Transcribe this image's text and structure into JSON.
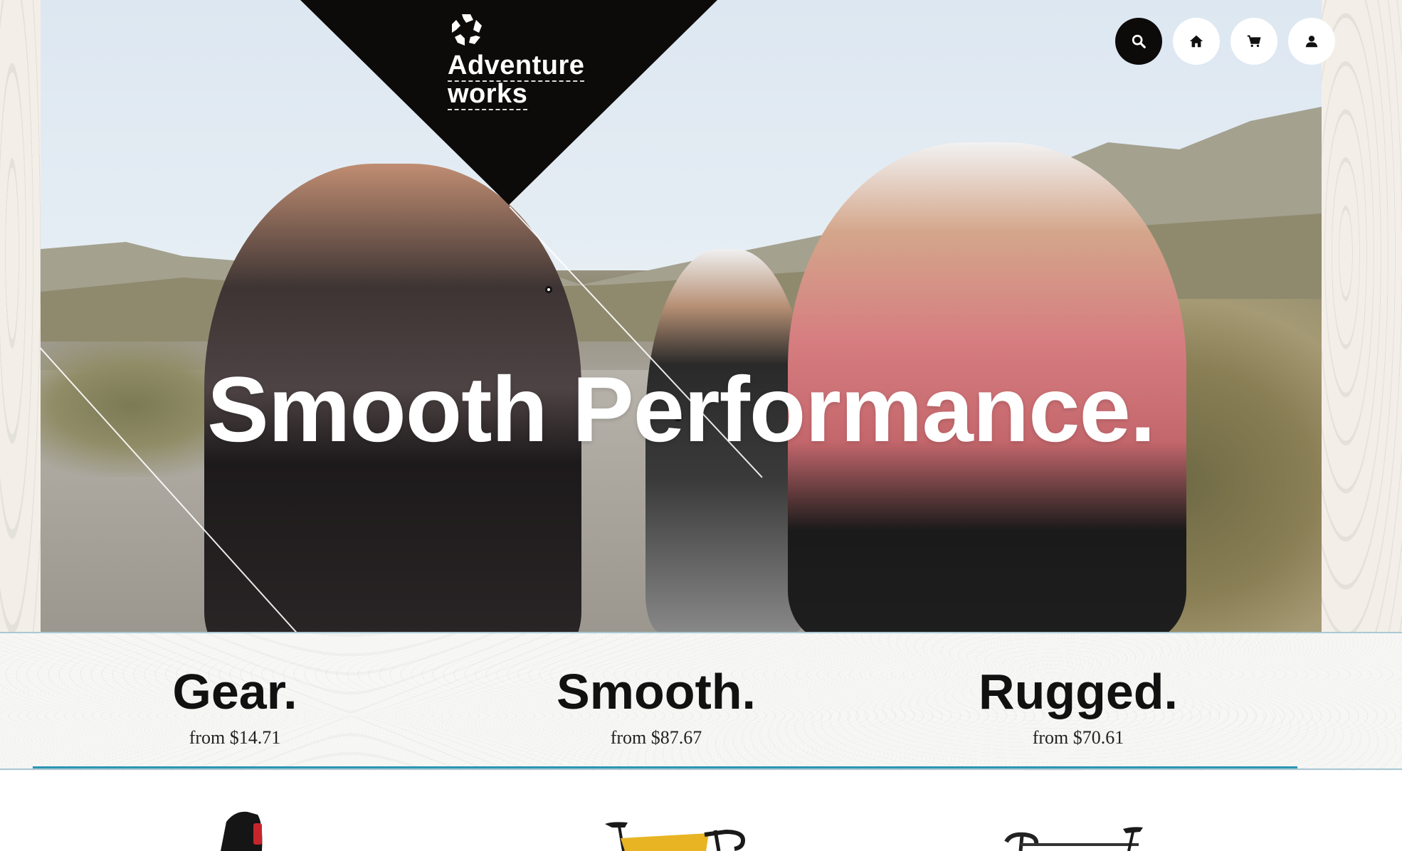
{
  "brand": {
    "line1": "Adventure",
    "line2": "works"
  },
  "topnav": {
    "search": "search-icon",
    "home": "home-icon",
    "cart": "cart-icon",
    "account": "user-icon"
  },
  "hero": {
    "headline": "Smooth Performance."
  },
  "categories": [
    {
      "title": "Gear.",
      "price": "from $14.71"
    },
    {
      "title": "Smooth.",
      "price": "from $87.67"
    },
    {
      "title": "Rugged.",
      "price": "from $70.61"
    }
  ],
  "colors": {
    "accent": "#2b96b3",
    "dark": "#0c0b0a",
    "background": "#f4f1ec"
  }
}
